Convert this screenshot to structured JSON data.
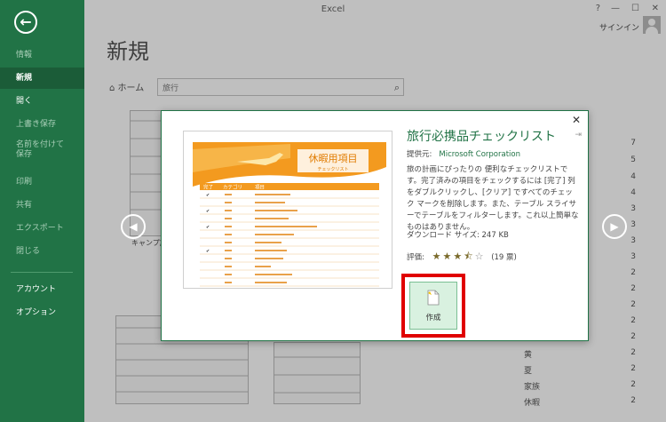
{
  "app": {
    "title": "Excel",
    "signin": "サインイン",
    "window_controls": [
      "?",
      "—",
      "☐",
      "✕"
    ]
  },
  "sidebar": {
    "items": [
      {
        "label": "情報",
        "state": "disabled"
      },
      {
        "label": "新規",
        "state": "selected"
      },
      {
        "label": "開く",
        "state": "enabled"
      },
      {
        "label": "上書き保存",
        "state": "disabled"
      },
      {
        "label": "名前を付けて\n保存",
        "state": "disabled"
      },
      {
        "label": "印刷",
        "state": "disabled"
      },
      {
        "label": "共有",
        "state": "disabled"
      },
      {
        "label": "エクスポート",
        "state": "disabled"
      },
      {
        "label": "閉じる",
        "state": "disabled"
      },
      {
        "label": "アカウント",
        "state": "enabled"
      },
      {
        "label": "オプション",
        "state": "enabled"
      }
    ]
  },
  "main": {
    "page_title": "新規",
    "home_label": "ホーム",
    "search_value": "旅行",
    "caption_fragment": "キャンプ旅",
    "right_list_numbers": [
      "7",
      "5",
      "4",
      "4",
      "3",
      "3",
      "3",
      "3",
      "2",
      "2",
      "2",
      "2",
      "2",
      "2"
    ],
    "right_list_labels": [
      "",
      "",
      "",
      "",
      "",
      "",
      "",
      "",
      "",
      "",
      "",
      "黄",
      "夏",
      "家族",
      "休暇"
    ],
    "right_list_bottom_numbers": [
      "2",
      "2",
      "2",
      "2"
    ]
  },
  "dialog": {
    "title": "旅行必携品チェックリスト",
    "provider_label": "提供元:",
    "provider_value": "Microsoft Corporation",
    "description": "旅の計画にぴったりの 便利なチェックリストです。完了済みの項目をチェックするには [完了] 列をダブルクリックし、[クリア] ですべてのチェック マークを削除します。また、テーブル スライサーでテーブルをフィルターします。これ以上簡単なものはありません。",
    "download_size": "ダウンロード サイズ:  247 KB",
    "rating_label": "評価:",
    "rating_stars": 3.5,
    "rating_count": "(19 票)",
    "create_label": "作成",
    "preview": {
      "banner_title": "休暇用項目",
      "banner_subtitle": "チェックリスト",
      "col_done": "完了",
      "col_category": "カテゴリ",
      "col_item": "項目"
    }
  },
  "colors": {
    "accent": "#217346",
    "highlight": "#e00000",
    "preview_orange": "#f39a1f"
  }
}
